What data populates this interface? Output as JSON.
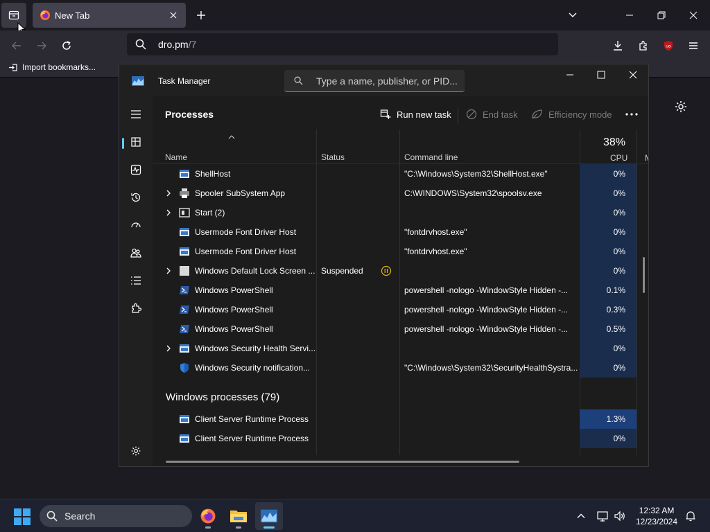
{
  "browser": {
    "tab_title": "New Tab",
    "url_host": "dro.pm",
    "url_path": "/7",
    "bookmark_import": "Import bookmarks..."
  },
  "taskmanager": {
    "title": "Task Manager",
    "search_placeholder": "Type a name, publisher, or PID...",
    "section": "Processes",
    "toolbar": {
      "run_new_task": "Run new task",
      "end_task": "End task",
      "efficiency_mode": "Efficiency mode"
    },
    "columns": {
      "name": "Name",
      "status": "Status",
      "command": "Command line",
      "cpu_pct": "38%",
      "cpu": "CPU",
      "next": "M"
    },
    "rows": [
      {
        "name": "ShellHost",
        "status": "",
        "cmd": "\"C:\\Windows\\System32\\ShellHost.exe\"",
        "cpu": "0%"
      },
      {
        "name": "Spooler SubSystem App",
        "status": "",
        "cmd": "C:\\WINDOWS\\System32\\spoolsv.exe",
        "cpu": "0%"
      },
      {
        "name": "Start (2)",
        "status": "",
        "cmd": "",
        "cpu": "0%"
      },
      {
        "name": "Usermode Font Driver Host",
        "status": "",
        "cmd": "\"fontdrvhost.exe\"",
        "cpu": "0%"
      },
      {
        "name": "Usermode Font Driver Host",
        "status": "",
        "cmd": "\"fontdrvhost.exe\"",
        "cpu": "0%"
      },
      {
        "name": "Windows Default Lock Screen ...",
        "status": "Suspended",
        "cmd": "",
        "cpu": "0%"
      },
      {
        "name": "Windows PowerShell",
        "status": "",
        "cmd": "powershell  -nologo -WindowStyle Hidden -...",
        "cpu": "0.1%"
      },
      {
        "name": "Windows PowerShell",
        "status": "",
        "cmd": "powershell  -nologo -WindowStyle Hidden -...",
        "cpu": "0.3%"
      },
      {
        "name": "Windows PowerShell",
        "status": "",
        "cmd": "powershell  -nologo -WindowStyle Hidden -...",
        "cpu": "0.5%"
      },
      {
        "name": "Windows Security Health Servi...",
        "status": "",
        "cmd": "",
        "cpu": "0%"
      },
      {
        "name": "Windows Security notification...",
        "status": "",
        "cmd": "\"C:\\Windows\\System32\\SecurityHealthSystra...",
        "cpu": "0%"
      }
    ],
    "group_title": "Windows processes (79)",
    "group_rows": [
      {
        "name": "Client Server Runtime Process",
        "cmd": "",
        "cpu": "1.3%"
      },
      {
        "name": "Client Server Runtime Process",
        "cmd": "",
        "cpu": "0%"
      }
    ]
  },
  "taskbar": {
    "search_label": "Search",
    "time": "12:32 AM",
    "date": "12/23/2024"
  },
  "colors": {
    "accent": "#60cdff",
    "cpu_cell": "#1a2d4d",
    "cpu_cell_hot": "#1d3f7a"
  }
}
